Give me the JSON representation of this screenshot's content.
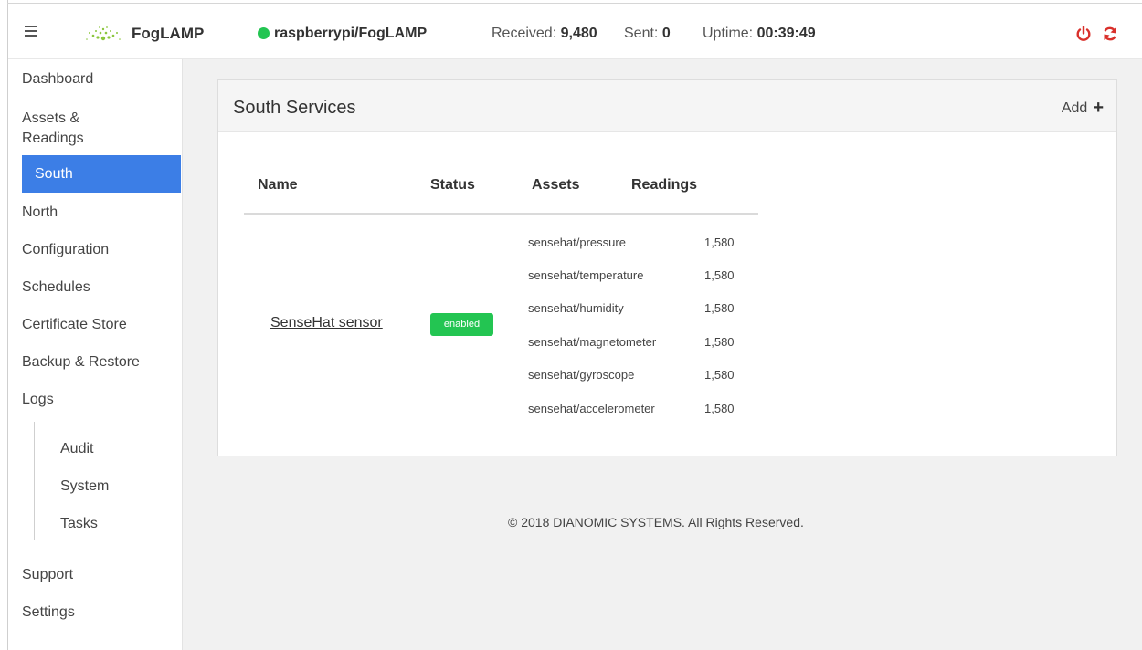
{
  "navbar": {
    "brand": "FogLAMP",
    "connection": "raspberrypi/FogLAMP",
    "received_label": "Received:",
    "received_value": "9,480",
    "sent_label": "Sent:",
    "sent_value": "0",
    "uptime_label": "Uptime:",
    "uptime_value": "00:39:49",
    "colors": {
      "connected": "#23c552",
      "action_icons": "#d9302b"
    }
  },
  "sidebar": {
    "items": [
      {
        "label": "Dashboard"
      },
      {
        "label": "Assets & Readings"
      },
      {
        "label": "South"
      },
      {
        "label": "North"
      },
      {
        "label": "Configuration"
      },
      {
        "label": "Schedules"
      },
      {
        "label": "Certificate Store"
      },
      {
        "label": "Backup & Restore"
      },
      {
        "label": "Logs"
      },
      {
        "label": "Audit"
      },
      {
        "label": "System"
      },
      {
        "label": "Tasks"
      },
      {
        "label": "Support"
      },
      {
        "label": "Settings"
      }
    ],
    "active": "South",
    "active_color": "#3c7ee6"
  },
  "main": {
    "title": "South Services",
    "add_label": "Add",
    "columns": [
      "Name",
      "Status",
      "Assets",
      "Readings"
    ],
    "services": [
      {
        "name": "SenseHat sensor",
        "status": "enabled",
        "assets": [
          {
            "name": "sensehat/pressure",
            "readings": "1,580"
          },
          {
            "name": "sensehat/temperature",
            "readings": "1,580"
          },
          {
            "name": "sensehat/humidity",
            "readings": "1,580"
          },
          {
            "name": "sensehat/magnetometer",
            "readings": "1,580"
          },
          {
            "name": "sensehat/gyroscope",
            "readings": "1,580"
          },
          {
            "name": "sensehat/accelerometer",
            "readings": "1,580"
          }
        ]
      }
    ]
  },
  "footer": {
    "text": "© 2018 DIANOMIC SYSTEMS. All Rights Reserved."
  }
}
